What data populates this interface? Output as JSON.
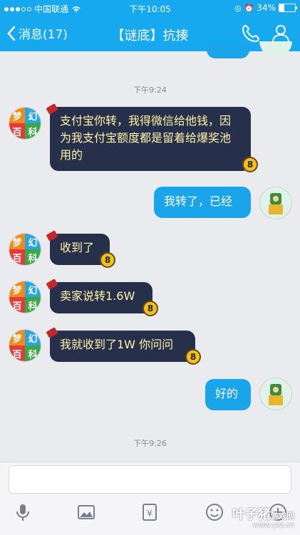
{
  "status_bar": {
    "carrier": "中国联通",
    "time": "下午10:05",
    "battery": "34%",
    "battery_level": 0.34
  },
  "nav": {
    "back_label": "消息(17)",
    "title": "【谜底】抗揍",
    "phone_icon": "phone-icon",
    "contact_icon": "person-icon",
    "accent_color": "#16a9f0"
  },
  "chat": {
    "time_1": "下午9:24",
    "messages": [
      {
        "sender": "other",
        "text": "支付宝你转，我得微信给他钱，因为我支付宝额度都是留着给爆奖池用的"
      },
      {
        "sender": "self",
        "text": "我转了，已经"
      },
      {
        "sender": "other",
        "text": "收到了"
      },
      {
        "sender": "other",
        "text": "卖家说转1.6W"
      },
      {
        "sender": "other",
        "text": "我就收到了1W 你问问"
      },
      {
        "sender": "self",
        "text": "好的"
      }
    ],
    "time_2": "下午9:26",
    "avatar_other_glyphs": [
      "梦",
      "幻",
      "百",
      "科"
    ],
    "badge_text": "8"
  },
  "input": {
    "placeholder": "",
    "tools": [
      "microphone-icon",
      "image-icon",
      "red-packet-icon",
      "emoji-icon",
      "plus-icon"
    ]
  },
  "watermark": {
    "text": "叶子猪",
    "sub": "游戏网",
    "url": "www.yzz.cn"
  }
}
